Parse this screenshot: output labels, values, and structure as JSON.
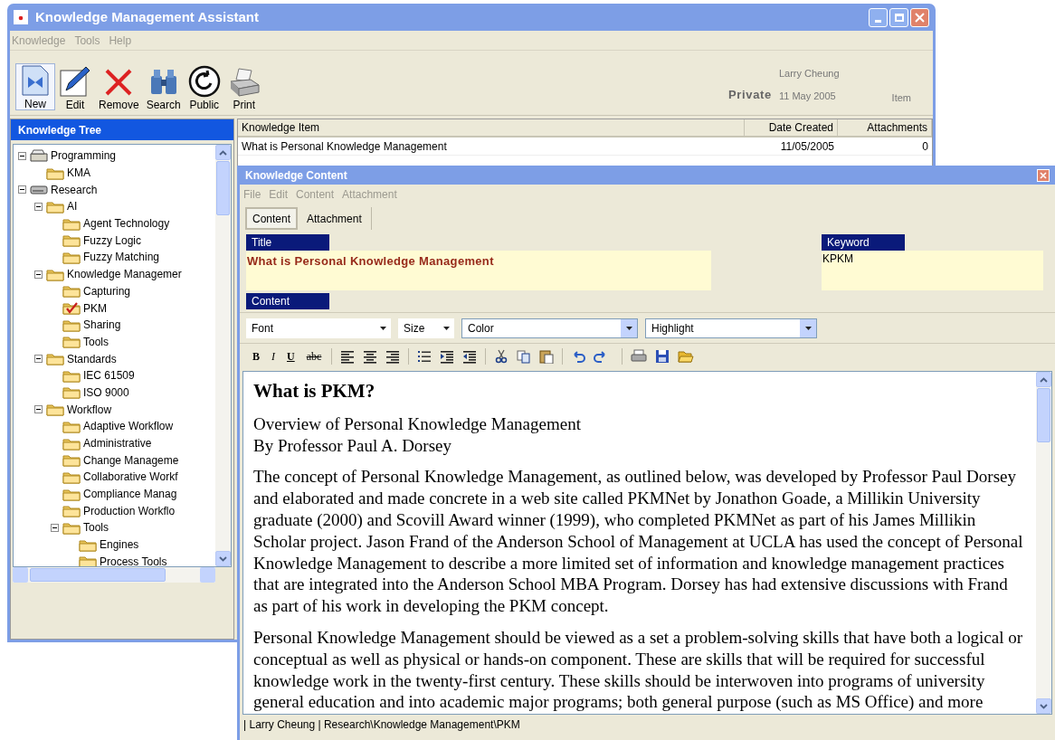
{
  "main_window": {
    "title": "Knowledge Management Assistant",
    "menu": [
      "Knowledge",
      "Tools",
      "Help"
    ],
    "toolbar": [
      {
        "label": "New",
        "kind": "new"
      },
      {
        "label": "Edit",
        "kind": "edit"
      },
      {
        "label": "Remove",
        "kind": "remove"
      },
      {
        "label": "Search",
        "kind": "search"
      },
      {
        "label": "Public",
        "kind": "public"
      },
      {
        "label": "Print",
        "kind": "print"
      }
    ],
    "item_info": {
      "visibility": "Private",
      "author": "Larry Cheung",
      "date": "11 May 2005",
      "type": "Item"
    },
    "tree": {
      "title": "Knowledge Tree",
      "items": [
        {
          "label": "Programming",
          "kind": "drawer",
          "expanded": true,
          "selected": false,
          "children": [
            {
              "label": "KMA",
              "kind": "folder",
              "selected": false
            }
          ]
        },
        {
          "label": "Research",
          "kind": "drive",
          "expanded": true,
          "selected": false,
          "children": [
            {
              "label": "AI",
              "kind": "folder",
              "expanded": true,
              "selected": false,
              "children": [
                {
                  "label": "Agent Technology",
                  "kind": "folder",
                  "selected": false
                },
                {
                  "label": "Fuzzy Logic",
                  "kind": "folder",
                  "selected": false
                },
                {
                  "label": "Fuzzy Matching",
                  "kind": "folder",
                  "selected": false
                }
              ]
            },
            {
              "label": "Knowledge Managemer",
              "kind": "folder",
              "expanded": true,
              "selected": false,
              "children": [
                {
                  "label": "Capturing",
                  "kind": "folder",
                  "selected": false
                },
                {
                  "label": "PKM",
                  "kind": "folder",
                  "selected": true
                },
                {
                  "label": "Sharing",
                  "kind": "folder",
                  "selected": false
                },
                {
                  "label": "Tools",
                  "kind": "folder",
                  "selected": false
                }
              ]
            },
            {
              "label": "Standards",
              "kind": "folder",
              "expanded": true,
              "selected": false,
              "children": [
                {
                  "label": "IEC 61509",
                  "kind": "folder",
                  "selected": false
                },
                {
                  "label": "ISO 9000",
                  "kind": "folder",
                  "selected": false
                }
              ]
            },
            {
              "label": "Workflow",
              "kind": "folder",
              "expanded": true,
              "selected": false,
              "children": [
                {
                  "label": "Adaptive Workflow",
                  "kind": "folder",
                  "selected": false
                },
                {
                  "label": "Administrative",
                  "kind": "folder",
                  "selected": false
                },
                {
                  "label": "Change Manageme",
                  "kind": "folder",
                  "selected": false
                },
                {
                  "label": "Collaborative Workf",
                  "kind": "folder",
                  "selected": false
                },
                {
                  "label": "Compliance Manag",
                  "kind": "folder",
                  "selected": false
                },
                {
                  "label": "Production Workflo",
                  "kind": "folder",
                  "selected": false
                },
                {
                  "label": "Tools",
                  "kind": "folder",
                  "expanded": true,
                  "selected": false,
                  "children": [
                    {
                      "label": "Engines",
                      "kind": "folder",
                      "selected": false
                    },
                    {
                      "label": "Process Tools",
                      "kind": "folder",
                      "selected": false
                    }
                  ]
                }
              ]
            }
          ]
        }
      ]
    },
    "list": {
      "columns": [
        "Knowledge Item",
        "Date Created",
        "Attachments"
      ],
      "rows": [
        {
          "cells": [
            "What is Personal Knowledge Management",
            "11/05/2005",
            "0"
          ]
        }
      ]
    }
  },
  "content_window": {
    "title": "Knowledge Content",
    "menu": [
      "File",
      "Edit",
      "Content",
      "Attachment"
    ],
    "tabs": [
      {
        "label": "Content",
        "selected": true
      },
      {
        "label": "Attachment",
        "selected": false
      }
    ],
    "title_label": "Title",
    "title_value": "What is Personal Knowledge Management",
    "keyword_label": "Keyword",
    "keyword_value": "KPKM",
    "content_label": "Content",
    "dropdowns": [
      "Font",
      "Size",
      "Color",
      "Highlight"
    ],
    "format_buttons": [
      {
        "label": "B",
        "kind": "bold"
      },
      {
        "label": "I",
        "kind": "italic"
      },
      {
        "label": "U",
        "kind": "underline"
      },
      {
        "label": "abc",
        "kind": "strike"
      }
    ],
    "document": {
      "heading": "What is PKM?",
      "paragraphs": [
        [
          "Overview of Personal Knowledge Management",
          "By Professor Paul A. Dorsey"
        ],
        [
          "The concept of Personal Knowledge Management, as outlined below, was developed by Professor Paul Dorsey and elaborated and made concrete in a web site called PKMNet by Jonathon Goade, a Millikin University graduate (2000) and Scovill Award winner (1999), who completed PKMNet as part of his James Millikin Scholar project. Jason Frand of the Anderson School of Management at UCLA has used the concept of Personal Knowledge Management to describe a more limited set of information and knowledge management practices that are integrated into the Anderson School MBA Program. Dorsey has had extensive discussions with Frand as part of his work in developing the PKM concept."
        ],
        [
          "Personal Knowledge Management should be viewed as a set a problem-solving skills that have both a logical or conceptual as well as physical or hands-on component. These are skills that will be required for successful knowledge work in the twenty-first century. These skills should be interwoven into programs of university general education and into academic major programs; both general purpose (such as MS Office) and more"
        ]
      ]
    },
    "status": "| Larry Cheung | Research\\Knowledge Management\\PKM"
  }
}
